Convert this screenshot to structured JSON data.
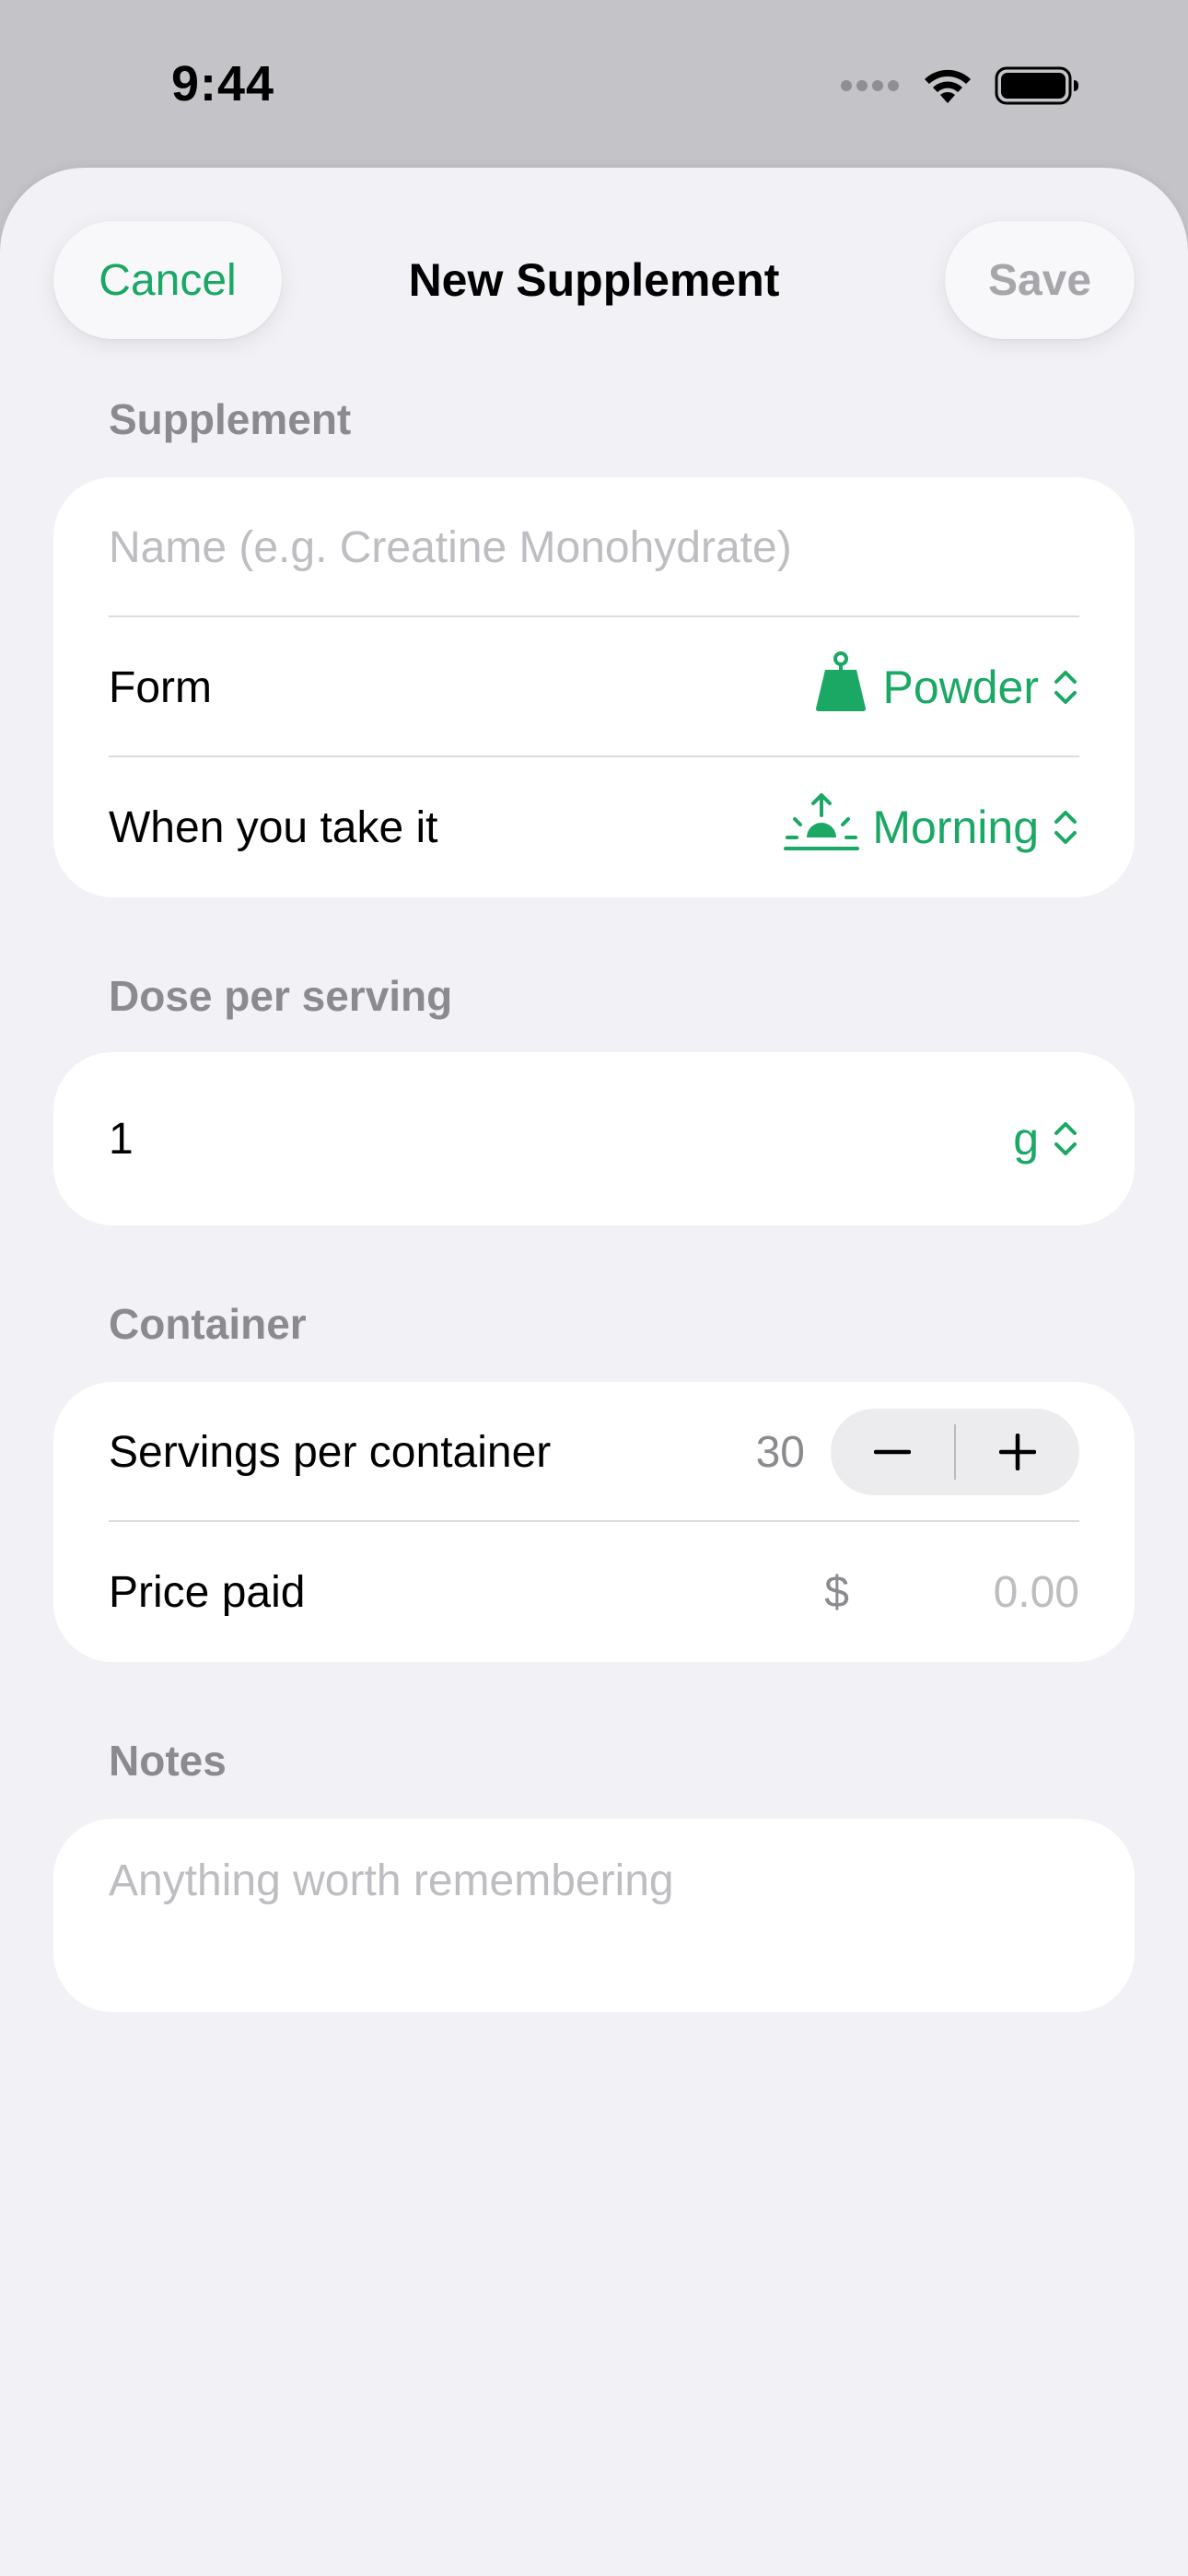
{
  "status_bar": {
    "time": "9:44",
    "signal_icon": "cellular-dots-icon",
    "wifi_icon": "wifi-icon",
    "battery_icon": "battery-icon"
  },
  "nav": {
    "cancel_label": "Cancel",
    "title": "New Supplement",
    "save_label": "Save"
  },
  "colors": {
    "accent": "#1aa864",
    "muted": "#8a8a8f",
    "placeholder": "#bdbdc2",
    "background": "#f1f1f6"
  },
  "supplement": {
    "section_label": "Supplement",
    "name_placeholder": "Name (e.g. Creatine Monohydrate)",
    "form_label": "Form",
    "form_value": "Powder",
    "form_icon": "scale-weight-icon",
    "when_label": "When you take it",
    "when_value": "Morning",
    "when_icon": "sunrise-icon"
  },
  "dose": {
    "section_label": "Dose per serving",
    "amount": "1",
    "unit": "g"
  },
  "container": {
    "section_label": "Container",
    "servings_label": "Servings per container",
    "servings_value": "30",
    "price_label": "Price paid",
    "currency_symbol": "$",
    "price_placeholder": "0.00"
  },
  "notes": {
    "section_label": "Notes",
    "placeholder": "Anything worth remembering"
  }
}
